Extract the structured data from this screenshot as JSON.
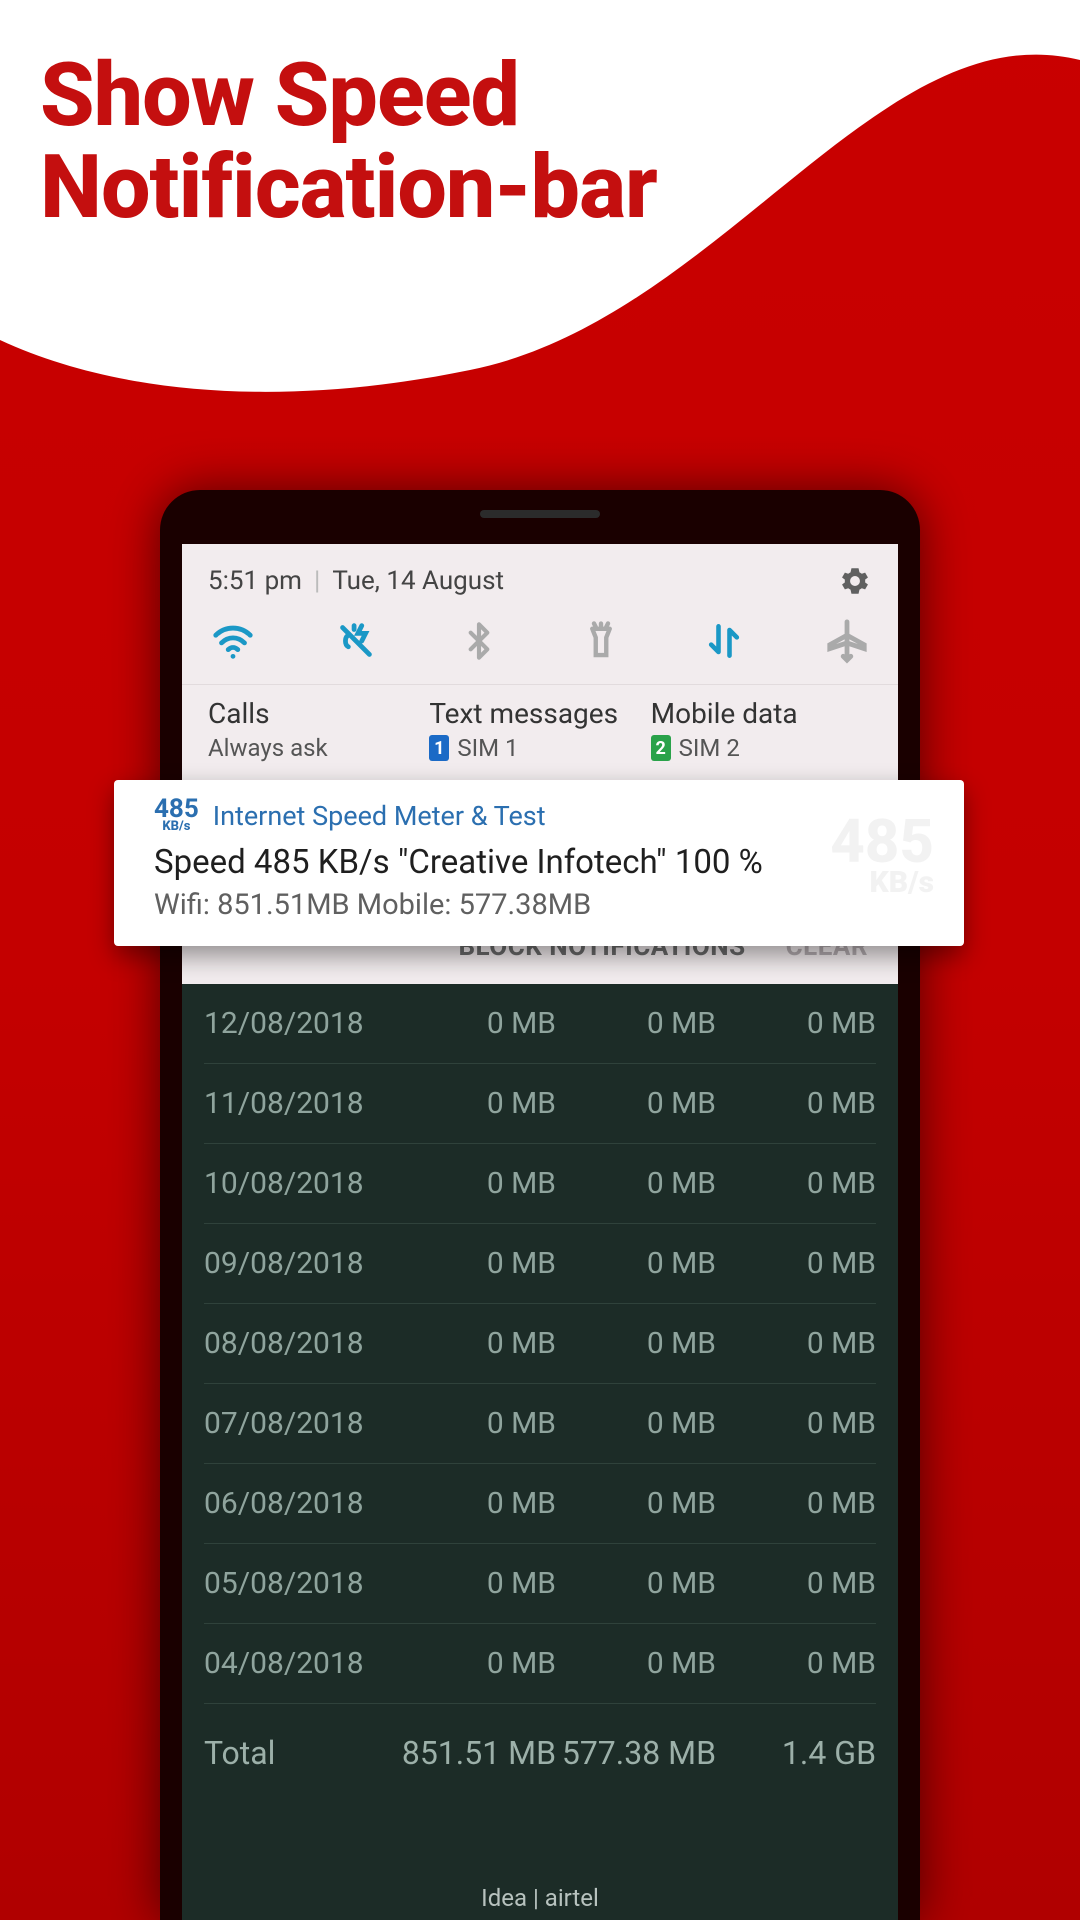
{
  "hero": {
    "line1": "Show Speed",
    "line2": "Notification-bar"
  },
  "statusbar": {
    "time": "5:51 pm",
    "date": "Tue, 14 August"
  },
  "sim_defaults": {
    "calls": {
      "label": "Calls",
      "value": "Always ask"
    },
    "texts": {
      "label": "Text messages",
      "badge": "1",
      "value": "SIM 1"
    },
    "data": {
      "label": "Mobile data",
      "badge": "2",
      "value": "SIM 2"
    }
  },
  "notif_card": {
    "speed_num": "485",
    "speed_unit": "KB/s",
    "app_name": "Internet Speed Meter & Test",
    "speed_line": "Speed 485 KB/s \"Creative Infotech\" 100 %",
    "usage_line": "Wifi: 851.51MB   Mobile: 577.38MB"
  },
  "actions": {
    "block": "BLOCK NOTIFICATIONS",
    "clear": "CLEAR"
  },
  "rows": [
    {
      "date": "12/08/2018",
      "wifi": "0 MB",
      "mob": "0 MB",
      "tot": "0 MB"
    },
    {
      "date": "11/08/2018",
      "wifi": "0 MB",
      "mob": "0 MB",
      "tot": "0 MB"
    },
    {
      "date": "10/08/2018",
      "wifi": "0 MB",
      "mob": "0 MB",
      "tot": "0 MB"
    },
    {
      "date": "09/08/2018",
      "wifi": "0 MB",
      "mob": "0 MB",
      "tot": "0 MB"
    },
    {
      "date": "08/08/2018",
      "wifi": "0 MB",
      "mob": "0 MB",
      "tot": "0 MB"
    },
    {
      "date": "07/08/2018",
      "wifi": "0 MB",
      "mob": "0 MB",
      "tot": "0 MB"
    },
    {
      "date": "06/08/2018",
      "wifi": "0 MB",
      "mob": "0 MB",
      "tot": "0 MB"
    },
    {
      "date": "05/08/2018",
      "wifi": "0 MB",
      "mob": "0 MB",
      "tot": "0 MB"
    },
    {
      "date": "04/08/2018",
      "wifi": "0 MB",
      "mob": "0 MB",
      "tot": "0 MB"
    }
  ],
  "total": {
    "label": "Total",
    "wifi": "851.51 MB",
    "mob": "577.38 MB",
    "tot": "1.4 GB"
  },
  "carrier": "Idea | airtel"
}
